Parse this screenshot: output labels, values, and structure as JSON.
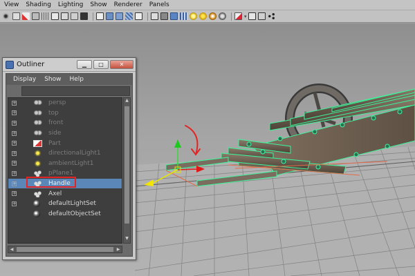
{
  "viewport": {
    "menu": [
      "View",
      "Shading",
      "Lighting",
      "Show",
      "Renderer",
      "Panels"
    ]
  },
  "outliner": {
    "title": "Outliner",
    "menu": [
      "Display",
      "Show",
      "Help"
    ],
    "items": [
      {
        "label": "persp",
        "icon": "camera-icon",
        "expandable": true,
        "visible": false,
        "selected": false
      },
      {
        "label": "top",
        "icon": "camera-icon",
        "expandable": true,
        "visible": false,
        "selected": false
      },
      {
        "label": "front",
        "icon": "camera-icon",
        "expandable": true,
        "visible": false,
        "selected": false
      },
      {
        "label": "side",
        "icon": "camera-icon",
        "expandable": true,
        "visible": false,
        "selected": false
      },
      {
        "label": "Part",
        "icon": "mesh-icon",
        "expandable": true,
        "visible": false,
        "selected": false
      },
      {
        "label": "directionalLight1",
        "icon": "directional-light-icon",
        "expandable": true,
        "visible": false,
        "selected": false
      },
      {
        "label": "ambientLight1",
        "icon": "ambient-light-icon",
        "expandable": true,
        "visible": false,
        "selected": false
      },
      {
        "label": "pPlane1",
        "icon": "group-icon",
        "expandable": true,
        "visible": false,
        "selected": false
      },
      {
        "label": "Handle",
        "icon": "group-icon",
        "expandable": true,
        "visible": true,
        "selected": true
      },
      {
        "label": "Axel",
        "icon": "group-icon",
        "expandable": true,
        "visible": true,
        "selected": false
      },
      {
        "label": "defaultLightSet",
        "icon": "set-icon",
        "expandable": true,
        "visible": true,
        "selected": false
      },
      {
        "label": "defaultObjectSet",
        "icon": "set-icon",
        "expandable": false,
        "visible": true,
        "selected": false
      }
    ]
  },
  "colors": {
    "selection_highlight": "#5b87b8",
    "annotation_red": "#e32424",
    "wireframe_green": "#3cf59a",
    "grid": "#7c7c7c"
  }
}
